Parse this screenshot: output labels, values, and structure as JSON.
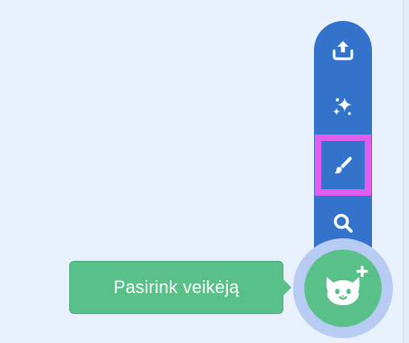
{
  "sprite_menu": {
    "tooltip_label": "Pasirink veikėją",
    "items": [
      {
        "icon": "upload-icon"
      },
      {
        "icon": "surprise-sparkle-icon"
      },
      {
        "icon": "paint-brush-icon"
      },
      {
        "icon": "search-icon"
      }
    ],
    "main_button_icon": "cat-add-icon",
    "highlighted_item": "paint-brush-icon"
  },
  "colors": {
    "background": "#e9f1fc",
    "menu_blue": "#3373cc",
    "button_green": "#59c08a",
    "halo_blue": "#b7cbf3",
    "highlight_magenta": "#e25ef0"
  }
}
